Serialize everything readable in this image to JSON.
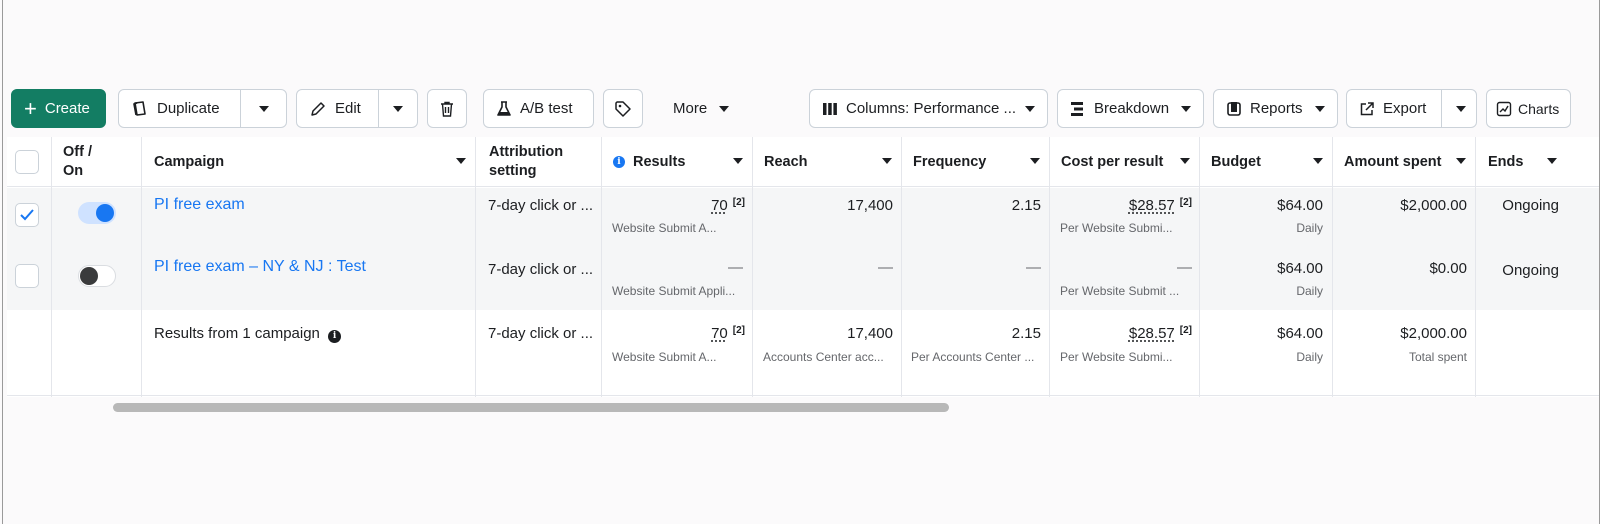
{
  "toolbar": {
    "create": "Create",
    "duplicate": "Duplicate",
    "edit": "Edit",
    "ab_test": "A/B test",
    "more": "More",
    "columns": "Columns: Performance ...",
    "breakdown": "Breakdown",
    "reports": "Reports",
    "export": "Export",
    "charts": "Charts"
  },
  "columns": {
    "off_on": "Off / On",
    "campaign": "Campaign",
    "attribution": "Attribution setting",
    "results": "Results",
    "reach": "Reach",
    "frequency": "Frequency",
    "cost_per_result": "Cost per result",
    "budget": "Budget",
    "amount_spent": "Amount spent",
    "ends": "Ends"
  },
  "rows": [
    {
      "selected": true,
      "on": true,
      "campaign": "PI free exam",
      "attribution": "7-day click or ...",
      "results": "70",
      "results_note": "[2]",
      "results_sub": "Website Submit A...",
      "reach": "17,400",
      "frequency": "2.15",
      "cost_per_result": "$28.57",
      "cost_note": "[2]",
      "cost_sub": "Per Website Submi...",
      "budget": "$64.00",
      "budget_sub": "Daily",
      "amount_spent": "$2,000.00",
      "ends": "Ongoing"
    },
    {
      "selected": false,
      "on": false,
      "campaign": "PI free exam – NY & NJ : Test",
      "attribution": "7-day click or ...",
      "results": "—",
      "results_sub": "Website Submit Appli...",
      "reach": "—",
      "frequency": "—",
      "cost_per_result": "—",
      "cost_sub": "Per Website Submit ...",
      "budget": "$64.00",
      "budget_sub": "Daily",
      "amount_spent": "$0.00",
      "ends": "Ongoing"
    }
  ],
  "summary": {
    "label": "Results from 1 campaign",
    "attribution": "7-day click or ...",
    "results": "70",
    "results_note": "[2]",
    "results_sub": "Website Submit A...",
    "reach": "17,400",
    "reach_sub": "Accounts Center acc...",
    "frequency": "2.15",
    "frequency_sub": "Per Accounts Center ...",
    "cost_per_result": "$28.57",
    "cost_note": "[2]",
    "cost_sub": "Per Website Submi...",
    "budget": "$64.00",
    "budget_sub": "Daily",
    "amount_spent": "$2,000.00",
    "amount_sub": "Total spent"
  },
  "colors": {
    "create_bg": "#137d63",
    "link": "#1877f2",
    "toggle_on": "#1877f2",
    "info": "#1877f2"
  },
  "icons": [
    "plus-icon",
    "duplicate-icon",
    "pencil-icon",
    "trash-icon",
    "flask-icon",
    "tag-icon",
    "columns-icon",
    "breakdown-icon",
    "reports-icon",
    "export-icon",
    "chart-icon",
    "info-icon",
    "check-icon"
  ]
}
